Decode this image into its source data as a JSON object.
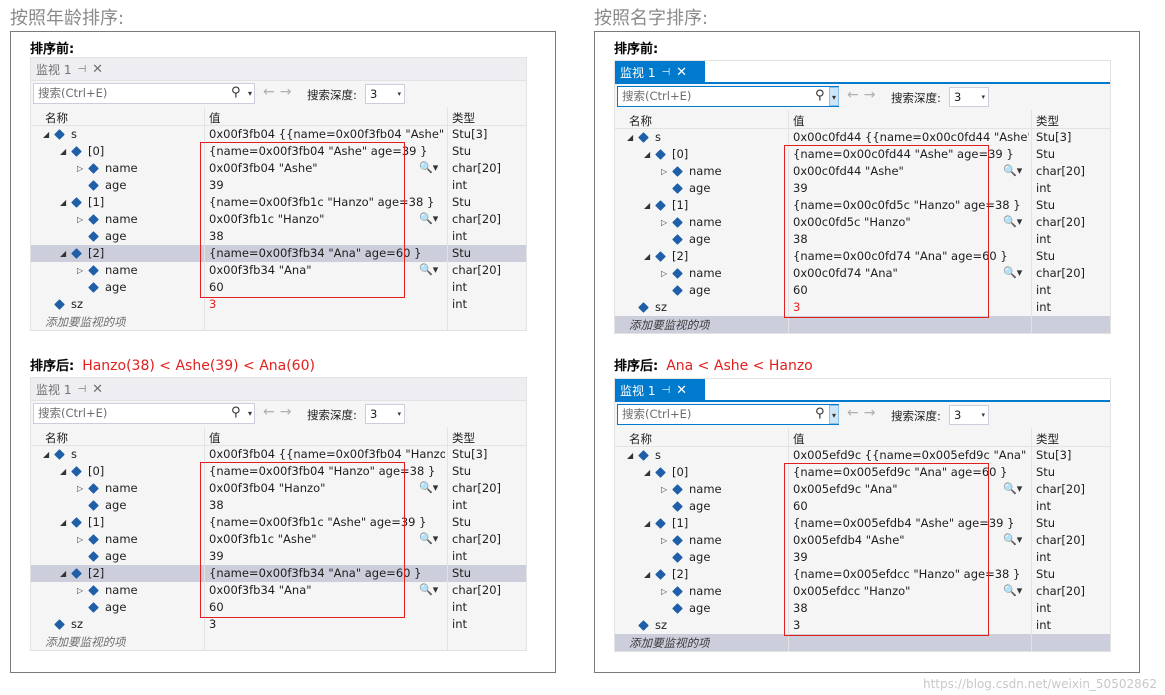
{
  "left": {
    "title": "按照年龄排序:",
    "before_label": "排序前:",
    "after_label": "排序后:",
    "after_note": "Hanzo(38) < Ashe(39) < Ana(60)"
  },
  "right": {
    "title": "按照名字排序:",
    "before_label": "排序前:",
    "after_label": "排序后:",
    "after_note": "Ana < Ashe < Hanzo"
  },
  "common": {
    "tab_label": "监视 1",
    "pin_glyph": "⊣",
    "close_glyph": "✕",
    "search_placeholder": "搜索(Ctrl+E)",
    "search_glyph": "⚲",
    "drop_glyph": "▾",
    "nav_glyph": "←→",
    "depth_label": "搜索深度:",
    "depth_value": "3",
    "col_name": "名称",
    "col_value": "值",
    "col_type": "类型",
    "add_item": "添加要监视的项",
    "mag_glyph": "🔍▾",
    "expanded_glyph": "◢",
    "collapsed_glyph": "▷"
  },
  "watches": {
    "w1": {
      "rows": [
        {
          "name": "s",
          "value": "0x00f3fb04 {{name=0x00f3fb04 \"Ashe\" age...",
          "type": "Stu[3]"
        },
        {
          "name": "[0]",
          "value": "{name=0x00f3fb04 \"Ashe\" age=39 }",
          "type": "Stu"
        },
        {
          "name": "name",
          "value": "0x00f3fb04 \"Ashe\"",
          "type": "char[20]"
        },
        {
          "name": "age",
          "value": "39",
          "type": "int"
        },
        {
          "name": "[1]",
          "value": "{name=0x00f3fb1c \"Hanzo\" age=38 }",
          "type": "Stu"
        },
        {
          "name": "name",
          "value": "0x00f3fb1c \"Hanzo\"",
          "type": "char[20]"
        },
        {
          "name": "age",
          "value": "38",
          "type": "int"
        },
        {
          "name": "[2]",
          "value": "{name=0x00f3fb34 \"Ana\" age=60 }",
          "type": "Stu"
        },
        {
          "name": "name",
          "value": "0x00f3fb34 \"Ana\"",
          "type": "char[20]"
        },
        {
          "name": "age",
          "value": "60",
          "type": "int"
        },
        {
          "name": "sz",
          "value": "3",
          "type": "int"
        }
      ]
    },
    "w2": {
      "rows": [
        {
          "name": "s",
          "value": "0x00f3fb04 {{name=0x00f3fb04 \"Hanzo\" ag...",
          "type": "Stu[3]"
        },
        {
          "name": "[0]",
          "value": "{name=0x00f3fb04 \"Hanzo\" age=38 }",
          "type": "Stu"
        },
        {
          "name": "name",
          "value": "0x00f3fb04 \"Hanzo\"",
          "type": "char[20]"
        },
        {
          "name": "age",
          "value": "38",
          "type": "int"
        },
        {
          "name": "[1]",
          "value": "{name=0x00f3fb1c \"Ashe\" age=39 }",
          "type": "Stu"
        },
        {
          "name": "name",
          "value": "0x00f3fb1c \"Ashe\"",
          "type": "char[20]"
        },
        {
          "name": "age",
          "value": "39",
          "type": "int"
        },
        {
          "name": "[2]",
          "value": "{name=0x00f3fb34 \"Ana\" age=60 }",
          "type": "Stu"
        },
        {
          "name": "name",
          "value": "0x00f3fb34 \"Ana\"",
          "type": "char[20]"
        },
        {
          "name": "age",
          "value": "60",
          "type": "int"
        },
        {
          "name": "sz",
          "value": "3",
          "type": "int"
        }
      ]
    },
    "w3": {
      "rows": [
        {
          "name": "s",
          "value": "0x00c0fd44 {{name=0x00c0fd44 \"Ashe\" age...",
          "type": "Stu[3]"
        },
        {
          "name": "[0]",
          "value": "{name=0x00c0fd44 \"Ashe\" age=39 }",
          "type": "Stu"
        },
        {
          "name": "name",
          "value": "0x00c0fd44 \"Ashe\"",
          "type": "char[20]"
        },
        {
          "name": "age",
          "value": "39",
          "type": "int"
        },
        {
          "name": "[1]",
          "value": "{name=0x00c0fd5c \"Hanzo\" age=38 }",
          "type": "Stu"
        },
        {
          "name": "name",
          "value": "0x00c0fd5c \"Hanzo\"",
          "type": "char[20]"
        },
        {
          "name": "age",
          "value": "38",
          "type": "int"
        },
        {
          "name": "[2]",
          "value": "{name=0x00c0fd74 \"Ana\" age=60 }",
          "type": "Stu"
        },
        {
          "name": "name",
          "value": "0x00c0fd74 \"Ana\"",
          "type": "char[20]"
        },
        {
          "name": "age",
          "value": "60",
          "type": "int"
        },
        {
          "name": "sz",
          "value": "3",
          "type": "int"
        }
      ]
    },
    "w4": {
      "rows": [
        {
          "name": "s",
          "value": "0x005efd9c {{name=0x005efd9c \"Ana\" age...",
          "type": "Stu[3]"
        },
        {
          "name": "[0]",
          "value": "{name=0x005efd9c \"Ana\" age=60 }",
          "type": "Stu"
        },
        {
          "name": "name",
          "value": "0x005efd9c \"Ana\"",
          "type": "char[20]"
        },
        {
          "name": "age",
          "value": "60",
          "type": "int"
        },
        {
          "name": "[1]",
          "value": "{name=0x005efdb4 \"Ashe\" age=39 }",
          "type": "Stu"
        },
        {
          "name": "name",
          "value": "0x005efdb4 \"Ashe\"",
          "type": "char[20]"
        },
        {
          "name": "age",
          "value": "39",
          "type": "int"
        },
        {
          "name": "[2]",
          "value": "{name=0x005efdcc \"Hanzo\" age=38 }",
          "type": "Stu"
        },
        {
          "name": "name",
          "value": "0x005efdcc \"Hanzo\"",
          "type": "char[20]"
        },
        {
          "name": "age",
          "value": "38",
          "type": "int"
        },
        {
          "name": "sz",
          "value": "3",
          "type": "int"
        }
      ]
    }
  },
  "colors": {
    "accent": "#007acc",
    "highlight": "#e0201e",
    "selected_row": "#cccedb"
  },
  "watermark": "https://blog.csdn.net/weixin_50502862"
}
